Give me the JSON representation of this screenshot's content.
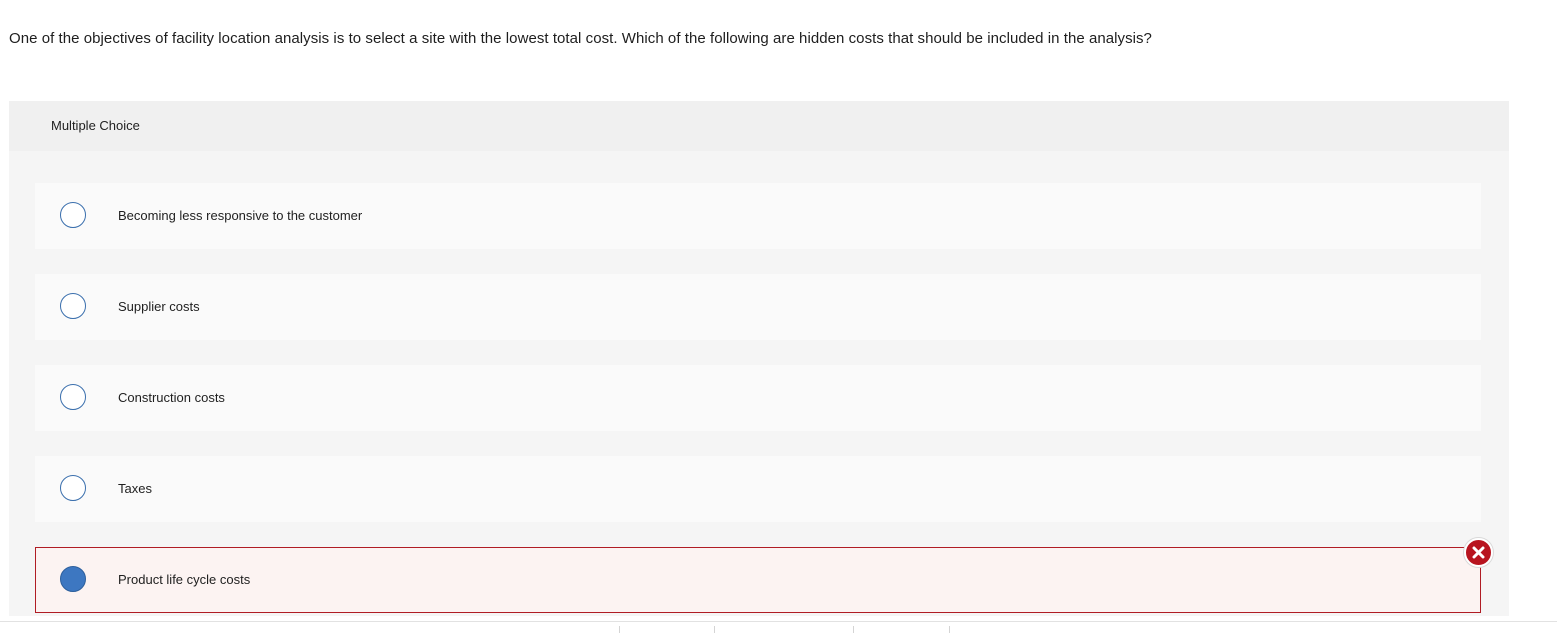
{
  "question": {
    "text": "One of the objectives of facility location analysis is to select a site with the lowest total cost. Which of the following are hidden costs that should be included in the analysis?"
  },
  "multiple_choice": {
    "header_label": "Multiple Choice",
    "options": [
      {
        "label": "Becoming less responsive to the customer",
        "selected": false
      },
      {
        "label": "Supplier costs",
        "selected": false
      },
      {
        "label": "Construction costs",
        "selected": false
      },
      {
        "label": "Taxes",
        "selected": false
      },
      {
        "label": "Product life cycle costs",
        "selected": true
      }
    ],
    "result_icon": "incorrect-x-icon"
  },
  "colors": {
    "radio_border": "#3a6fad",
    "radio_selected_fill": "#3d77c1",
    "incorrect_border": "#b01c24",
    "incorrect_background": "#fcf3f2",
    "incorrect_icon": "#b8141f"
  }
}
